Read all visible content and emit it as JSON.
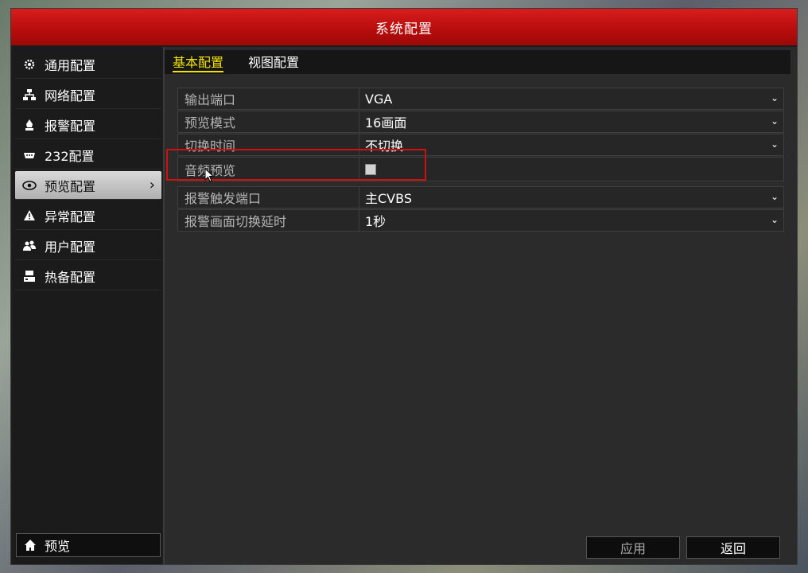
{
  "window": {
    "title": "系统配置"
  },
  "sidebar": {
    "items": [
      {
        "label": "通用配置",
        "icon": "gear-icon"
      },
      {
        "label": "网络配置",
        "icon": "network-icon"
      },
      {
        "label": "报警配置",
        "icon": "alarm-icon"
      },
      {
        "label": "232配置",
        "icon": "serial-port-icon"
      },
      {
        "label": "预览配置",
        "icon": "eye-icon",
        "active": true
      },
      {
        "label": "异常配置",
        "icon": "warning-icon"
      },
      {
        "label": "用户配置",
        "icon": "users-icon"
      },
      {
        "label": "热备配置",
        "icon": "hot-spare-icon"
      }
    ],
    "preview_button": {
      "label": "预览",
      "icon": "home-icon"
    }
  },
  "tabs": [
    {
      "label": "基本配置",
      "active": true
    },
    {
      "label": "视图配置",
      "active": false
    }
  ],
  "settings": {
    "rows": [
      {
        "label": "输出端口",
        "value": "VGA",
        "type": "dropdown"
      },
      {
        "label": "预览模式",
        "value": "16画面",
        "type": "dropdown"
      },
      {
        "label": "切换时间",
        "value": "不切换",
        "type": "dropdown"
      },
      {
        "label": "音频预览",
        "value": "",
        "type": "checkbox",
        "checked": false
      },
      {
        "label": "报警触发端口",
        "value": "主CVBS",
        "type": "dropdown"
      },
      {
        "label": "报警画面切换延时",
        "value": "1秒",
        "type": "dropdown"
      }
    ]
  },
  "buttons": {
    "apply_label": "应用",
    "back_label": "返回"
  },
  "colors": {
    "title_bar": "#c41212",
    "active_tab": "#f2e200",
    "highlight_box": "#d01010",
    "disabled_text": "#a8a8a8"
  }
}
